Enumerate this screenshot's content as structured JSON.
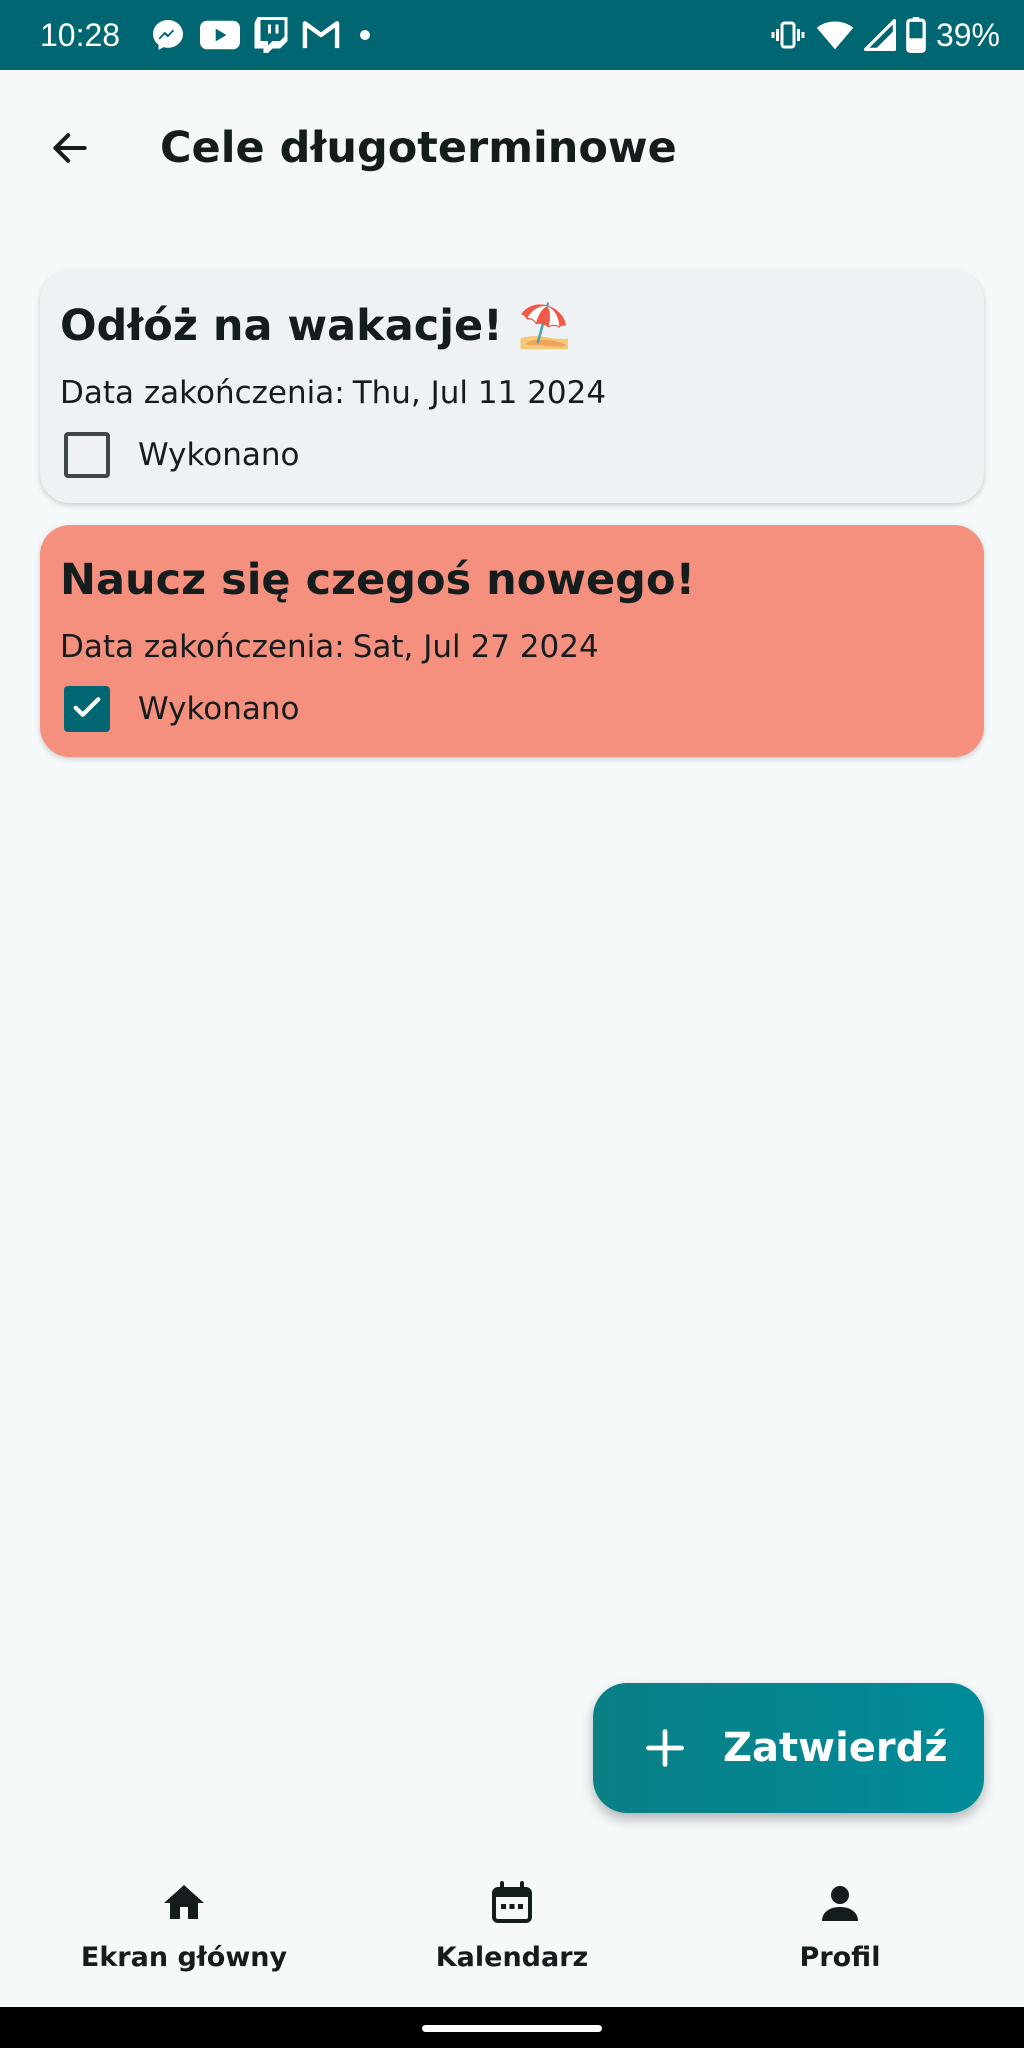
{
  "status_bar": {
    "time": "10:28",
    "battery": "39%",
    "notification_icons": [
      "messenger-icon",
      "youtube-icon",
      "twitch-icon",
      "gmail-icon",
      "dot-icon"
    ],
    "system_icons": [
      "vibrate-icon",
      "wifi-icon",
      "cell-signal-icon",
      "battery-icon"
    ]
  },
  "header": {
    "title": "Cele długoterminowe",
    "back_icon": "arrow-back-icon"
  },
  "goals": [
    {
      "title": "Odłóż na wakacje! ⛱️",
      "date_label": "Data zakończenia:",
      "date_value": "Thu, Jul 11 2024",
      "done_label": "Wykonano",
      "done": false,
      "card_color": "#eef2f5"
    },
    {
      "title": "Naucz się czegoś nowego!",
      "date_label": "Data zakończenia:",
      "date_value": "Sat, Jul 27 2024",
      "done_label": "Wykonano",
      "done": true,
      "card_color": "#f6907e"
    }
  ],
  "fab": {
    "label": "Zatwierdź",
    "icon": "plus-icon"
  },
  "bottom_nav": {
    "items": [
      {
        "label": "Ekran główny",
        "icon": "home-icon"
      },
      {
        "label": "Kalendarz",
        "icon": "calendar-icon"
      },
      {
        "label": "Profil",
        "icon": "person-icon"
      }
    ]
  },
  "colors": {
    "primary": "#006672",
    "background": "#f5f9fa",
    "completed_card": "#f6907e",
    "pending_card": "#eef2f5"
  }
}
